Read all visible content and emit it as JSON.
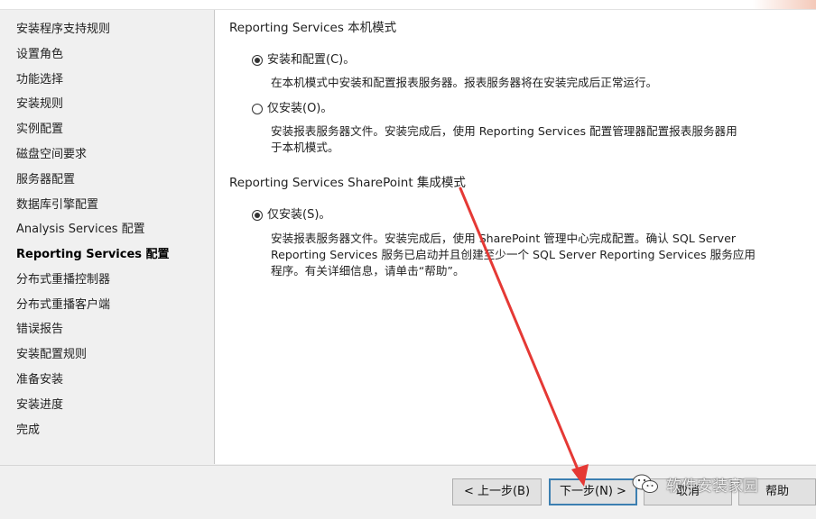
{
  "sidebar": {
    "steps": [
      {
        "label": "安装程序支持规则"
      },
      {
        "label": "设置角色"
      },
      {
        "label": "功能选择"
      },
      {
        "label": "安装规则"
      },
      {
        "label": "实例配置"
      },
      {
        "label": "磁盘空间要求"
      },
      {
        "label": "服务器配置"
      },
      {
        "label": "数据库引擎配置"
      },
      {
        "label": "Analysis Services 配置"
      },
      {
        "label": "Reporting Services 配置"
      },
      {
        "label": "分布式重播控制器"
      },
      {
        "label": "分布式重播客户端"
      },
      {
        "label": "错误报告"
      },
      {
        "label": "安装配置规则"
      },
      {
        "label": "准备安装"
      },
      {
        "label": "安装进度"
      },
      {
        "label": "完成"
      }
    ],
    "active_step": "Reporting Services 配置"
  },
  "native_mode": {
    "title": "Reporting Services 本机模式",
    "install_configure": {
      "label": "安装和配置(C)。",
      "selected": true,
      "description": "在本机模式中安装和配置报表服务器。报表服务器将在安装完成后正常运行。"
    },
    "install_only": {
      "label": "仅安装(O)。",
      "selected": false,
      "description_line1": "安装报表服务器文件。安装完成后，使用 Reporting Services 配置管理器配置报表服务器用",
      "description_line2": "于本机模式。"
    }
  },
  "sharepoint_mode": {
    "title": "Reporting Services SharePoint 集成模式",
    "install_only": {
      "label": "仅安装(S)。",
      "selected": true,
      "description_line1": "安装报表服务器文件。安装完成后，使用 SharePoint 管理中心完成配置。确认 SQL Server",
      "description_line2": "Reporting Services 服务已启动并且创建至少一个 SQL Server Reporting Services 服务应用",
      "description_line3": "程序。有关详细信息，请单击“帮助”。"
    }
  },
  "footer": {
    "back_label": "< 上一步(B)",
    "next_label": "下一步(N) >",
    "cancel_label": "取消",
    "help_label": "帮助"
  },
  "watermark": {
    "text": "软件安装家园",
    "icon": "wechat-icon"
  },
  "annotation": {
    "arrow_color": "#e53935"
  }
}
